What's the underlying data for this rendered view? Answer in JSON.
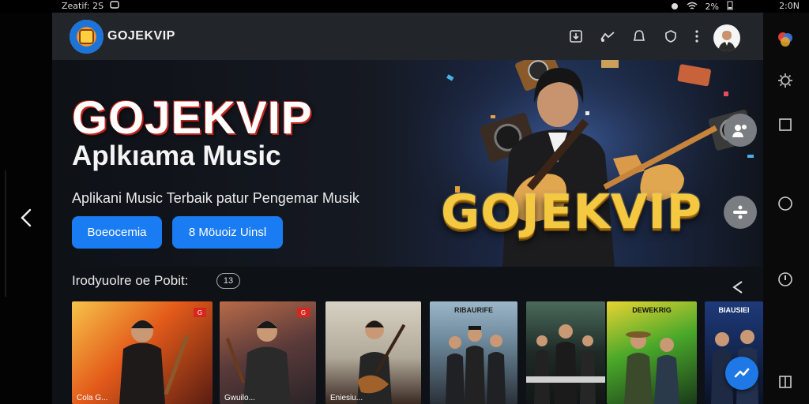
{
  "status_bar": {
    "left_text": "Zeatif: 2S",
    "battery": "2%",
    "time": "2:0N"
  },
  "app": {
    "brand": "GOJEKVIP",
    "topbar_icons": [
      "download-icon",
      "cast-icon",
      "notification-icon",
      "shield-icon",
      "more-icon"
    ]
  },
  "hero": {
    "title": "GOJEKVIP",
    "subtitle": "Aplkıama Music",
    "description": "Aplikani Music Terbaik patur Pengemar Musik",
    "button_primary": "Boeocemia",
    "button_secondary": "8 Möuoiz Uinsl",
    "art_logo": "GOJEKVIP"
  },
  "section": {
    "title": "Irodyuolre oe Pobit:",
    "badge": "13"
  },
  "cards": [
    {
      "caption": "Cola G...",
      "label": "",
      "tag": "G"
    },
    {
      "caption": "Gwuilo...",
      "label": "",
      "tag": "G"
    },
    {
      "caption": "Eniesiu...",
      "label": "",
      "tag": ""
    },
    {
      "caption": "",
      "label": "RIBAURIFE",
      "tag": ""
    },
    {
      "caption": "",
      "label": "",
      "tag": ""
    },
    {
      "caption": "",
      "label": "DEWEKRIG",
      "tag": ""
    },
    {
      "caption": "",
      "label": "BIAUSIEI",
      "tag": ""
    }
  ],
  "colors": {
    "accent": "#1a7cf2",
    "title_outline": "#c0231d",
    "gold": "#f5c842",
    "topbar": "#22252a",
    "background": "#0e1116"
  }
}
